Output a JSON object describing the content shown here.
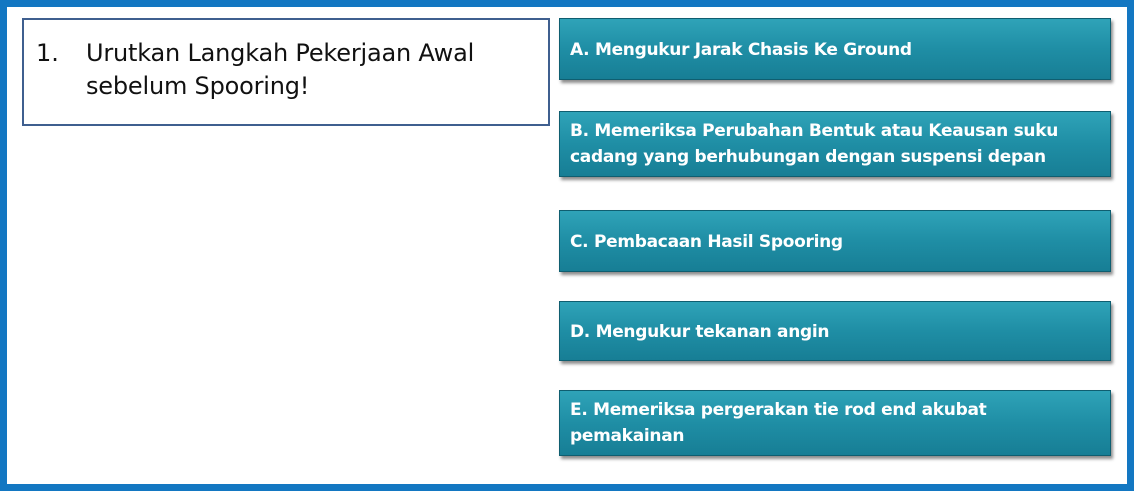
{
  "question": {
    "number": "1.",
    "text": "Urutkan Langkah Pekerjaan Awal sebelum Spooring!"
  },
  "answers": [
    {
      "label": "A. Mengukur Jarak Chasis Ke Ground"
    },
    {
      "label": "B. Memeriksa Perubahan Bentuk atau Keausan suku cadang yang berhubungan dengan suspensi depan"
    },
    {
      "label": "C. Pembacaan Hasil Spooring"
    },
    {
      "label": "D. Mengukur tekanan angin"
    },
    {
      "label": "E. Memeriksa pergerakan tie rod end akubat pemakainan"
    }
  ],
  "colors": {
    "frame_border": "#1377c2",
    "question_border": "#3f5f8f",
    "answer_fill": "#1f8ea5",
    "answer_text": "#ffffff"
  }
}
